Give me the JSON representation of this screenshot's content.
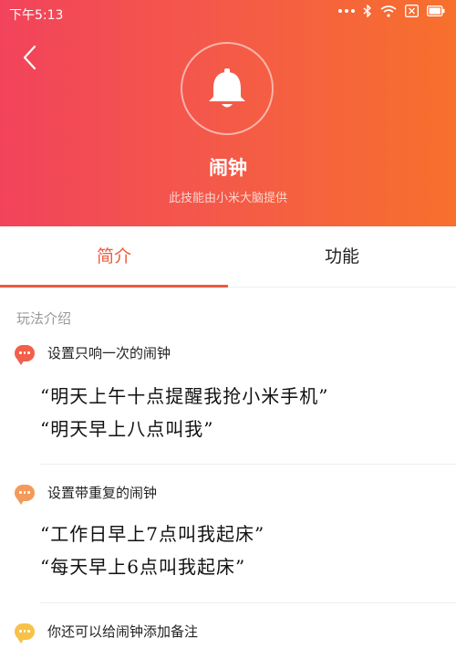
{
  "status": {
    "time": "下午5:13"
  },
  "header": {
    "title": "闹钟",
    "subtitle": "此技能由小米大脑提供"
  },
  "tabs": [
    {
      "label": "简介",
      "active": true
    },
    {
      "label": "功能",
      "active": false
    }
  ],
  "intro": {
    "section_label": "玩法介绍",
    "groups": [
      {
        "heading": "设置只响一次的闹钟",
        "bubble_color": "#f0604a",
        "examples": [
          "“明天上午十点提醒我抢小米手机”",
          "“明天早上八点叫我”"
        ]
      },
      {
        "heading": "设置带重复的闹钟",
        "bubble_color": "#f39a5a",
        "examples": [
          "“工作日早上7点叫我起床”",
          "“每天早上6点叫我起床”"
        ]
      },
      {
        "heading": "你还可以给闹钟添加备注",
        "bubble_color": "#f7c24a",
        "examples": []
      }
    ]
  },
  "colors": {
    "accent": "#f05a3f",
    "gradient_start": "#f2435b",
    "gradient_end": "#f7702c"
  }
}
